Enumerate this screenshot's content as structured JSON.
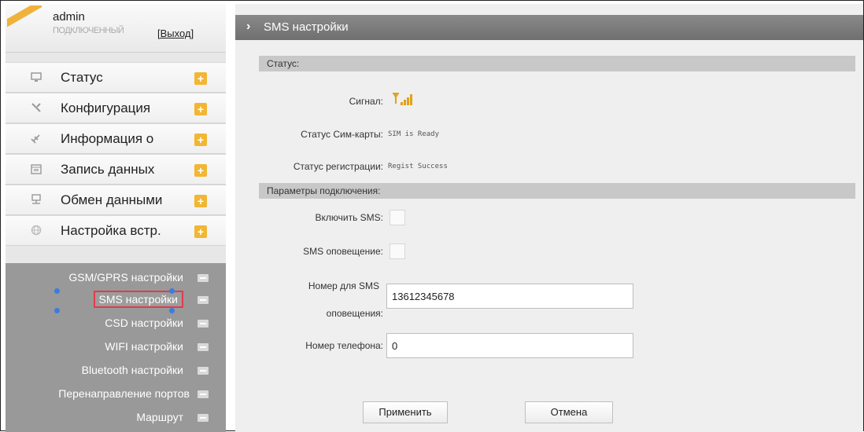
{
  "user": {
    "name": "admin",
    "subtitle": "ПОДКЛЮЧЕННЫЙ",
    "logout_label": "[Выход]"
  },
  "menu": [
    {
      "label": "Статус",
      "icon": "monitor-icon"
    },
    {
      "label": "Конфигурация",
      "icon": "tools-icon"
    },
    {
      "label": "Информация о",
      "icon": "satellite-icon"
    },
    {
      "label": "Запись данных",
      "icon": "calendar-icon"
    },
    {
      "label": "Обмен данными",
      "icon": "network-icon"
    },
    {
      "label": "Настройка встр.",
      "icon": "globe-icon"
    }
  ],
  "submenu": [
    {
      "label": "GSM/GPRS настройки"
    },
    {
      "label": "SMS настройки",
      "active": true
    },
    {
      "label": "CSD настройки"
    },
    {
      "label": "WIFI настройки"
    },
    {
      "label": "Bluetooth настройки"
    },
    {
      "label": "Перенаправление портов"
    },
    {
      "label": "Маршрут"
    }
  ],
  "page": {
    "title": "SMS настройки",
    "status_section": "Статус:",
    "signal_label": "Сигнал:",
    "sim_status_label": "Статус Сим-карты:",
    "sim_status_value": "SIM is Ready",
    "reg_status_label": "Статус регистрации:",
    "reg_status_value": "Regist Success",
    "conn_section": "Параметры подключения:",
    "enable_sms_label": "Включить SMS:",
    "sms_alert_label": "SMS оповещение:",
    "sms_number_label_1": "Номер для SMS",
    "sms_number_label_2": "оповещения:",
    "sms_number_value": "13612345678",
    "phone_label": "Номер телефона:",
    "phone_value": "0",
    "apply_label": "Применить",
    "cancel_label": "Отмена"
  },
  "colors": {
    "accent": "#f2b632",
    "submenu_bg": "#999999",
    "active_border": "#e23b4e",
    "title_bar": "#7a7a7a"
  }
}
